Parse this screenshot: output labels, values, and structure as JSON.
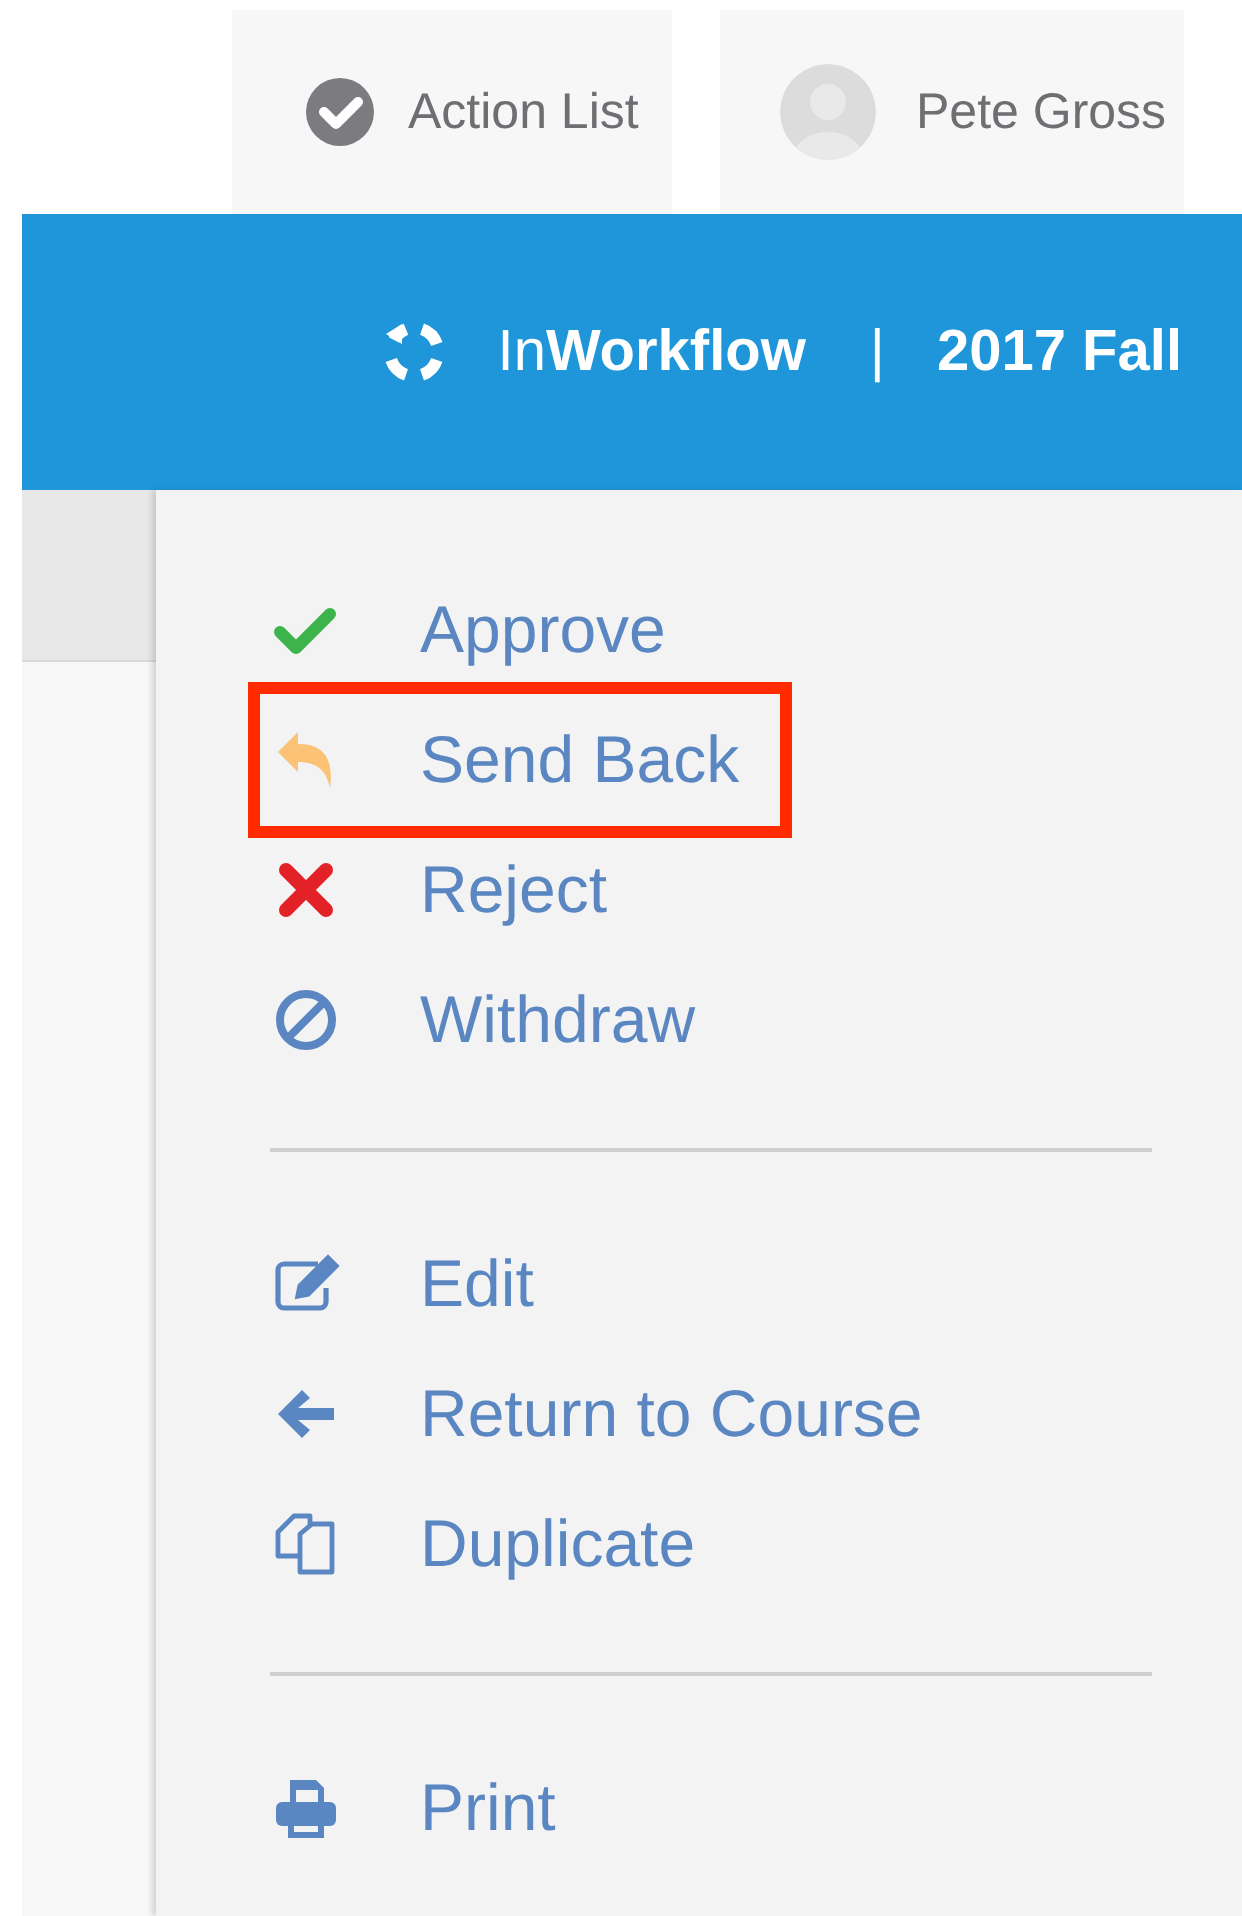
{
  "top_tabs": [
    {
      "label": "Action List",
      "kind": "check"
    },
    {
      "label": "Pete Gross",
      "kind": "avatar"
    }
  ],
  "header": {
    "brand": "In**Workflow**",
    "separator": "|",
    "term": "2017 Fall"
  },
  "menu": {
    "groups": [
      [
        {
          "label": "Approve",
          "kind": "check",
          "highlighted": false
        },
        {
          "label": "Send Back",
          "kind": "reply",
          "highlighted": true
        },
        {
          "label": "Reject",
          "kind": "cross",
          "highlighted": false
        },
        {
          "label": "Withdraw",
          "kind": "ban",
          "highlighted": false
        }
      ],
      [
        {
          "label": "Edit",
          "kind": "edit",
          "highlighted": false
        },
        {
          "label": "Return to Course",
          "kind": "arrow-left",
          "highlighted": false
        },
        {
          "label": "Duplicate",
          "kind": "copy",
          "highlighted": false
        }
      ],
      [
        {
          "label": "Print",
          "kind": "print",
          "highlighted": false
        }
      ]
    ]
  }
}
